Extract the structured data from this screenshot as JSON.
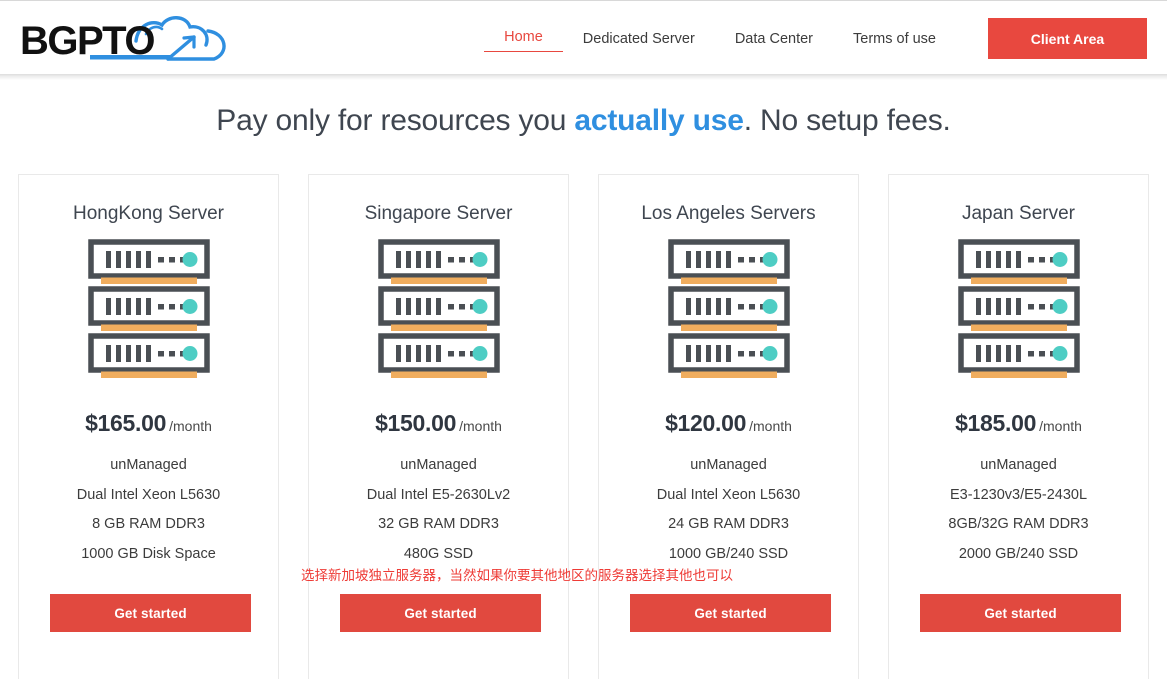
{
  "header": {
    "logo_text": "BGPTO",
    "logo_name": "bgpto-logo",
    "nav": [
      {
        "label": "Home",
        "active": true
      },
      {
        "label": "Dedicated Server",
        "active": false
      },
      {
        "label": "Data Center",
        "active": false
      },
      {
        "label": "Terms of use",
        "active": false
      }
    ],
    "client_area_label": "Client Area",
    "accent_color": "#e8483f"
  },
  "hero": {
    "headline_before": "Pay only for resources you ",
    "headline_accent": "actually use",
    "headline_after": ". No setup fees.",
    "accent_color": "#2f8fe0"
  },
  "plans": [
    {
      "title": "HongKong Server",
      "icon": "server-rack-icon",
      "price": "$165.00",
      "period": "/month",
      "specs": [
        "unManaged",
        "Dual Intel Xeon L5630",
        "8 GB RAM DDR3",
        "1000 GB Disk Space"
      ],
      "cta": "Get started",
      "note": ""
    },
    {
      "title": "Singapore Server",
      "icon": "server-rack-icon",
      "price": "$150.00",
      "period": "/month",
      "specs": [
        "unManaged",
        "Dual Intel E5-2630Lv2",
        "32 GB RAM DDR3",
        "480G SSD"
      ],
      "cta": "Get started",
      "note": "选择新加坡独立服务器，当然如果你要其他地区的服务器选择其他也可以"
    },
    {
      "title": "Los Angeles Servers",
      "icon": "server-rack-icon",
      "price": "$120.00",
      "period": "/month",
      "specs": [
        "unManaged",
        "Dual Intel Xeon L5630",
        "24 GB RAM DDR3",
        "1000 GB/240 SSD"
      ],
      "cta": "Get started",
      "note": ""
    },
    {
      "title": "Japan Server",
      "icon": "server-rack-icon",
      "price": "$185.00",
      "period": "/month",
      "specs": [
        "unManaged",
        "E3-1230v3/E5-2430L",
        "8GB/32G RAM DDR3",
        "2000 GB/240 SSD"
      ],
      "cta": "Get started",
      "note": ""
    }
  ],
  "theme": {
    "cta_red": "#e1493f",
    "icon_dark": "#4a4f54",
    "icon_orange": "#f0ad5e",
    "icon_cyan": "#4ecdc4",
    "note_red": "#ee3b36",
    "card_border": "#e9e9e9"
  }
}
